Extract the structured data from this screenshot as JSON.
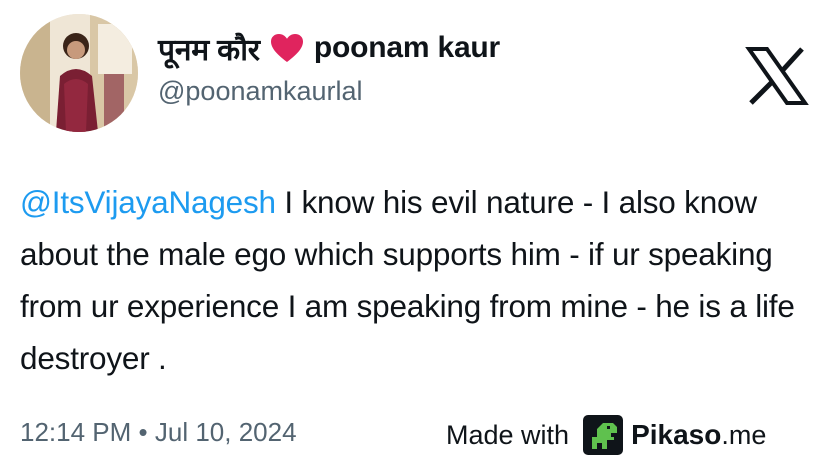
{
  "author": {
    "display_name_hindi": "पूनम कौर",
    "display_name": "poonam kaur",
    "handle": "@poonamkaurlal",
    "heart_color": "#e0245e"
  },
  "platform": {
    "logo": "x-logo-icon"
  },
  "tweet": {
    "mention": "@ItsVijayaNagesh",
    "body": " I know his evil nature - I also know about the male ego which supports him - if ur speaking from ur experience I am speaking from mine - he is a life destroyer .",
    "time": "12:14 PM",
    "separator": "•",
    "date": "Jul 10, 2024"
  },
  "watermark": {
    "label": "Made with",
    "brand": "Pikaso",
    "tld": ".me",
    "logo": "pikaso-dino-icon",
    "logo_color": "#5fc14e"
  },
  "colors": {
    "mention": "#1d9bf0",
    "secondary_text": "#536471",
    "text": "#0f1419"
  }
}
